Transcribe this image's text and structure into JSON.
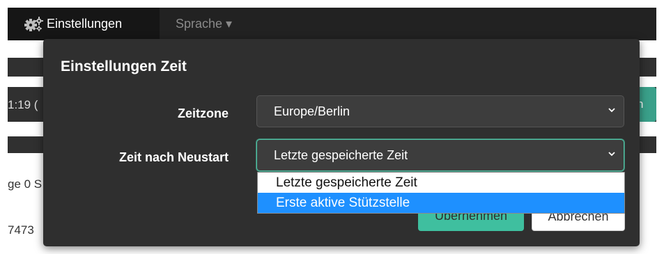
{
  "navbar": {
    "settings_label": "Einstellungen",
    "language_label": "Sprache ▾",
    "settings_icon": "gears-icon"
  },
  "background": {
    "time_fragment": "1:19 (",
    "button_fragment": "n",
    "text_fragment_1": "ge 0 S",
    "text_fragment_2": "7473"
  },
  "modal": {
    "title": "Einstellungen Zeit",
    "timezone_label": "Zeitzone",
    "timezone_value": "Europe/Berlin",
    "restart_label": "Zeit nach Neustart",
    "restart_value": "Letzte gespeicherte Zeit",
    "apply_label": "Übernehmen",
    "cancel_label": "Abbrechen"
  },
  "dropdown": {
    "options": [
      {
        "label": "Letzte gespeicherte Zeit",
        "selected": false
      },
      {
        "label": "Erste aktive Stützstelle",
        "selected": true
      }
    ]
  },
  "colors": {
    "accent": "#3fbf9f",
    "highlight": "#1e90ff",
    "modal_bg": "#2f2f2f"
  }
}
